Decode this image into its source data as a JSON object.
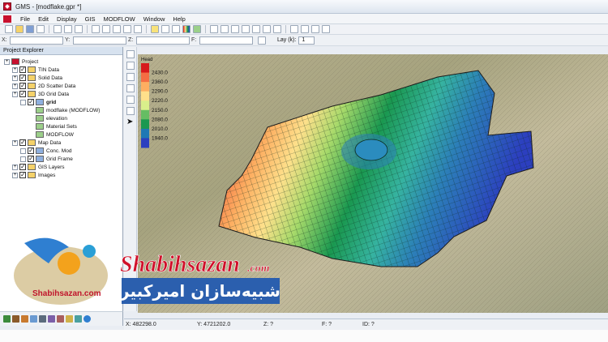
{
  "window": {
    "title": "GMS - [modflake.gpr *]"
  },
  "menu": [
    "File",
    "Edit",
    "Display",
    "GIS",
    "MODFLOW",
    "Window",
    "Help"
  ],
  "coords": {
    "x_label": "X:",
    "y_label": "Y:",
    "z_label": "Z:",
    "f_label": "F:",
    "lay_label": "Lay (k):",
    "lay_value": "1"
  },
  "explorer": {
    "header": "Project Explorer",
    "items": [
      {
        "label": "Project",
        "level": 0
      },
      {
        "label": "TIN Data",
        "level": 1
      },
      {
        "label": "Solid Data",
        "level": 1
      },
      {
        "label": "2D Scatter Data",
        "level": 1
      },
      {
        "label": "3D Grid Data",
        "level": 1
      },
      {
        "label": "grid",
        "level": 2
      },
      {
        "label": "modflake (MODFLOW)",
        "level": 3
      },
      {
        "label": "elevation",
        "level": 3
      },
      {
        "label": "Material Sets",
        "level": 3
      },
      {
        "label": "MODFLOW",
        "level": 3
      },
      {
        "label": "Map Data",
        "level": 1
      },
      {
        "label": "Conc. Mod",
        "level": 2
      },
      {
        "label": "Grid Frame",
        "level": 2
      },
      {
        "label": "GIS Layers",
        "level": 1
      },
      {
        "label": "Images",
        "level": 1
      }
    ]
  },
  "legend": {
    "title": "Head",
    "values": [
      "2430.0",
      "2360.0",
      "2290.0",
      "2220.0",
      "2150.0",
      "2080.0",
      "2010.0",
      "1940.0"
    ],
    "colors": [
      "#d7191c",
      "#f46d43",
      "#fdae61",
      "#fee08b",
      "#d9ef8b",
      "#66bd63",
      "#1a9850",
      "#1f78b4",
      "#2c3fbf"
    ]
  },
  "status": {
    "x": "X: 482298.0",
    "y": "Y: 4721202.0",
    "z": "Z: ?",
    "f": "F: ?",
    "id": "ID: ?"
  },
  "watermark": {
    "brand_latin": "Shabihsazan",
    "brand_domain": ".com",
    "brand_persian": "شبیه‌سازان امیرکبیر",
    "logo_text": "Shabihsazan.com"
  }
}
